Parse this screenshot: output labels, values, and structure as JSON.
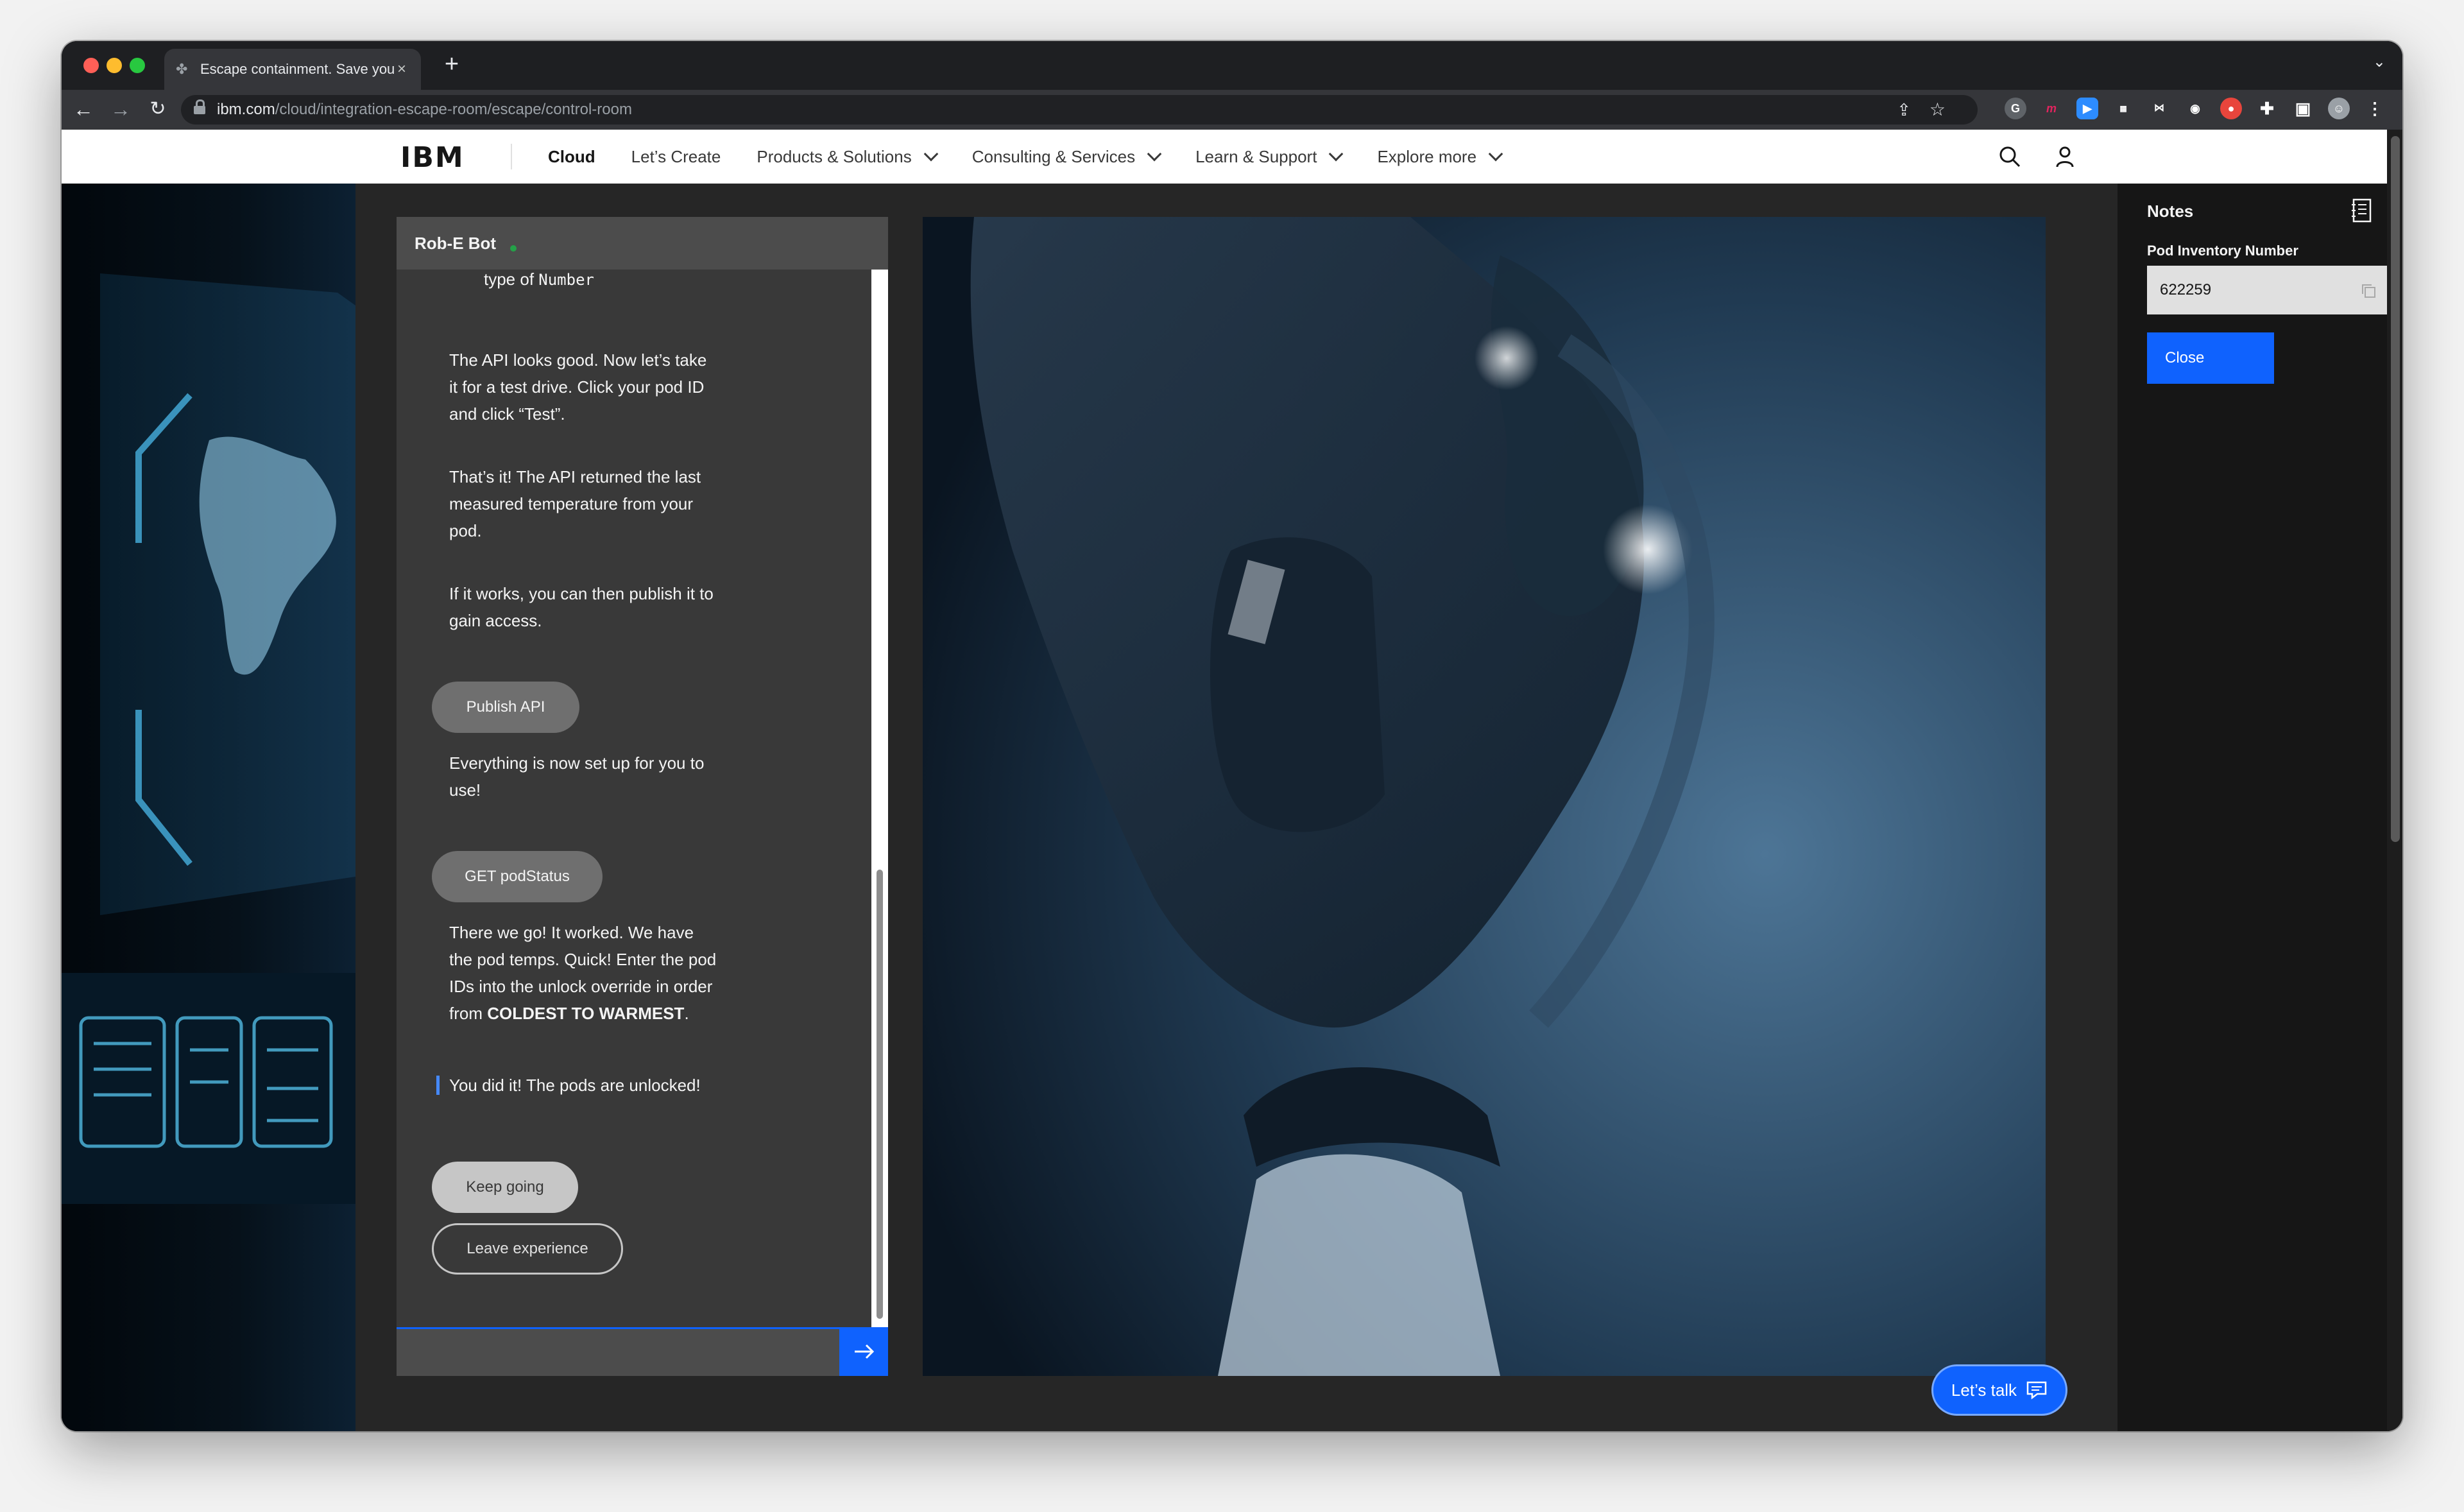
{
  "browser": {
    "tab_title": "Escape containment. Save your",
    "url_host": "ibm.com",
    "url_path": "/cloud/integration-escape-room/escape/control-room"
  },
  "nav": {
    "logo": "IBM",
    "links": [
      {
        "label": "Cloud"
      },
      {
        "label": "Let’s Create"
      },
      {
        "label": "Products & Solutions"
      },
      {
        "label": "Consulting & Services"
      },
      {
        "label": "Learn & Support"
      },
      {
        "label": "Explore more"
      }
    ]
  },
  "chat": {
    "title": "Rob-E Bot",
    "partial_prefix": "type of ",
    "partial_code": "Number",
    "messages": [
      "The API looks good. Now let’s take it for a test drive. Click your pod ID and click “Test”.",
      "That’s it! The API returned the last measured temperature from your pod.",
      "If it works, you can then publish it to gain access.",
      "Everything is now set up for you to use!",
      "There we go! It worked. We have the pod temps. Quick! Enter the pod IDs into the unlock override in order from ",
      "COLDEST TO WARMEST",
      ".",
      "You did it! The pods are unlocked!"
    ],
    "buttons": {
      "publish": "Publish API",
      "get_status": "GET podStatus",
      "keep_going": "Keep going",
      "leave": "Leave experience"
    }
  },
  "cta": {
    "lets_talk": "Let’s talk"
  },
  "notes": {
    "title": "Notes",
    "field_label": "Pod Inventory Number",
    "field_value": "622259",
    "close": "Close"
  },
  "colors": {
    "accent": "#0f62fe",
    "status": "#24a148"
  }
}
